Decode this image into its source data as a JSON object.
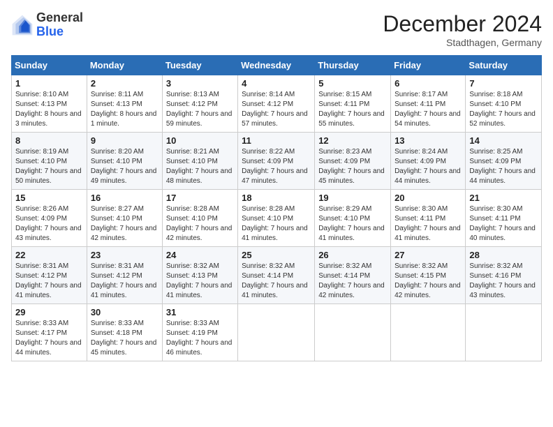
{
  "header": {
    "logo_general": "General",
    "logo_blue": "Blue",
    "month_title": "December 2024",
    "subtitle": "Stadthagen, Germany"
  },
  "days_of_week": [
    "Sunday",
    "Monday",
    "Tuesday",
    "Wednesday",
    "Thursday",
    "Friday",
    "Saturday"
  ],
  "weeks": [
    [
      {
        "day": "1",
        "sunrise": "Sunrise: 8:10 AM",
        "sunset": "Sunset: 4:13 PM",
        "daylight": "Daylight: 8 hours and 3 minutes."
      },
      {
        "day": "2",
        "sunrise": "Sunrise: 8:11 AM",
        "sunset": "Sunset: 4:13 PM",
        "daylight": "Daylight: 8 hours and 1 minute."
      },
      {
        "day": "3",
        "sunrise": "Sunrise: 8:13 AM",
        "sunset": "Sunset: 4:12 PM",
        "daylight": "Daylight: 7 hours and 59 minutes."
      },
      {
        "day": "4",
        "sunrise": "Sunrise: 8:14 AM",
        "sunset": "Sunset: 4:12 PM",
        "daylight": "Daylight: 7 hours and 57 minutes."
      },
      {
        "day": "5",
        "sunrise": "Sunrise: 8:15 AM",
        "sunset": "Sunset: 4:11 PM",
        "daylight": "Daylight: 7 hours and 55 minutes."
      },
      {
        "day": "6",
        "sunrise": "Sunrise: 8:17 AM",
        "sunset": "Sunset: 4:11 PM",
        "daylight": "Daylight: 7 hours and 54 minutes."
      },
      {
        "day": "7",
        "sunrise": "Sunrise: 8:18 AM",
        "sunset": "Sunset: 4:10 PM",
        "daylight": "Daylight: 7 hours and 52 minutes."
      }
    ],
    [
      {
        "day": "8",
        "sunrise": "Sunrise: 8:19 AM",
        "sunset": "Sunset: 4:10 PM",
        "daylight": "Daylight: 7 hours and 50 minutes."
      },
      {
        "day": "9",
        "sunrise": "Sunrise: 8:20 AM",
        "sunset": "Sunset: 4:10 PM",
        "daylight": "Daylight: 7 hours and 49 minutes."
      },
      {
        "day": "10",
        "sunrise": "Sunrise: 8:21 AM",
        "sunset": "Sunset: 4:10 PM",
        "daylight": "Daylight: 7 hours and 48 minutes."
      },
      {
        "day": "11",
        "sunrise": "Sunrise: 8:22 AM",
        "sunset": "Sunset: 4:09 PM",
        "daylight": "Daylight: 7 hours and 47 minutes."
      },
      {
        "day": "12",
        "sunrise": "Sunrise: 8:23 AM",
        "sunset": "Sunset: 4:09 PM",
        "daylight": "Daylight: 7 hours and 45 minutes."
      },
      {
        "day": "13",
        "sunrise": "Sunrise: 8:24 AM",
        "sunset": "Sunset: 4:09 PM",
        "daylight": "Daylight: 7 hours and 44 minutes."
      },
      {
        "day": "14",
        "sunrise": "Sunrise: 8:25 AM",
        "sunset": "Sunset: 4:09 PM",
        "daylight": "Daylight: 7 hours and 44 minutes."
      }
    ],
    [
      {
        "day": "15",
        "sunrise": "Sunrise: 8:26 AM",
        "sunset": "Sunset: 4:09 PM",
        "daylight": "Daylight: 7 hours and 43 minutes."
      },
      {
        "day": "16",
        "sunrise": "Sunrise: 8:27 AM",
        "sunset": "Sunset: 4:10 PM",
        "daylight": "Daylight: 7 hours and 42 minutes."
      },
      {
        "day": "17",
        "sunrise": "Sunrise: 8:28 AM",
        "sunset": "Sunset: 4:10 PM",
        "daylight": "Daylight: 7 hours and 42 minutes."
      },
      {
        "day": "18",
        "sunrise": "Sunrise: 8:28 AM",
        "sunset": "Sunset: 4:10 PM",
        "daylight": "Daylight: 7 hours and 41 minutes."
      },
      {
        "day": "19",
        "sunrise": "Sunrise: 8:29 AM",
        "sunset": "Sunset: 4:10 PM",
        "daylight": "Daylight: 7 hours and 41 minutes."
      },
      {
        "day": "20",
        "sunrise": "Sunrise: 8:30 AM",
        "sunset": "Sunset: 4:11 PM",
        "daylight": "Daylight: 7 hours and 41 minutes."
      },
      {
        "day": "21",
        "sunrise": "Sunrise: 8:30 AM",
        "sunset": "Sunset: 4:11 PM",
        "daylight": "Daylight: 7 hours and 40 minutes."
      }
    ],
    [
      {
        "day": "22",
        "sunrise": "Sunrise: 8:31 AM",
        "sunset": "Sunset: 4:12 PM",
        "daylight": "Daylight: 7 hours and 41 minutes."
      },
      {
        "day": "23",
        "sunrise": "Sunrise: 8:31 AM",
        "sunset": "Sunset: 4:12 PM",
        "daylight": "Daylight: 7 hours and 41 minutes."
      },
      {
        "day": "24",
        "sunrise": "Sunrise: 8:32 AM",
        "sunset": "Sunset: 4:13 PM",
        "daylight": "Daylight: 7 hours and 41 minutes."
      },
      {
        "day": "25",
        "sunrise": "Sunrise: 8:32 AM",
        "sunset": "Sunset: 4:14 PM",
        "daylight": "Daylight: 7 hours and 41 minutes."
      },
      {
        "day": "26",
        "sunrise": "Sunrise: 8:32 AM",
        "sunset": "Sunset: 4:14 PM",
        "daylight": "Daylight: 7 hours and 42 minutes."
      },
      {
        "day": "27",
        "sunrise": "Sunrise: 8:32 AM",
        "sunset": "Sunset: 4:15 PM",
        "daylight": "Daylight: 7 hours and 42 minutes."
      },
      {
        "day": "28",
        "sunrise": "Sunrise: 8:32 AM",
        "sunset": "Sunset: 4:16 PM",
        "daylight": "Daylight: 7 hours and 43 minutes."
      }
    ],
    [
      {
        "day": "29",
        "sunrise": "Sunrise: 8:33 AM",
        "sunset": "Sunset: 4:17 PM",
        "daylight": "Daylight: 7 hours and 44 minutes."
      },
      {
        "day": "30",
        "sunrise": "Sunrise: 8:33 AM",
        "sunset": "Sunset: 4:18 PM",
        "daylight": "Daylight: 7 hours and 45 minutes."
      },
      {
        "day": "31",
        "sunrise": "Sunrise: 8:33 AM",
        "sunset": "Sunset: 4:19 PM",
        "daylight": "Daylight: 7 hours and 46 minutes."
      },
      null,
      null,
      null,
      null
    ]
  ]
}
